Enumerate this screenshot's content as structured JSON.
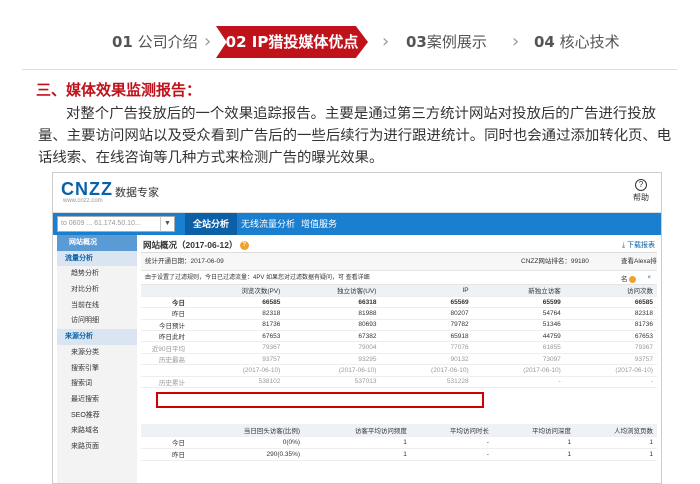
{
  "steps": [
    {
      "num": "01",
      "label": "公司介绍"
    },
    {
      "num": "02",
      "label": "IP猎投媒体优点"
    },
    {
      "num": "03",
      "label": "案例展示"
    },
    {
      "num": "04",
      "label": "核心技术"
    }
  ],
  "section_title": "三、媒体效果监测报告：",
  "paragraph": "对整个广告投放后的一个效果追踪报告。主要是通过第三方统计网站对投放后的广告进行投放量、主要访问网站以及受众看到广告后的一些后续行为进行跟进统计。同时也会通过添加转化页、电话线索、在线咨询等几种方式来检测广告的曝光效果。",
  "screenshot": {
    "logo": "CNZZ",
    "logo_sub": "www.cnzz.com",
    "brand": "数据专家",
    "help": "帮助",
    "site_select": "to 0609 ... 61.174.50.10...",
    "tabs": [
      "全站分析",
      "无线流量分析",
      "增值服务"
    ],
    "sidebar": [
      {
        "label": "网站概况",
        "type": "head"
      },
      {
        "label": "流量分析",
        "type": "group"
      },
      {
        "label": "趋势分析",
        "type": "item"
      },
      {
        "label": "对比分析",
        "type": "item"
      },
      {
        "label": "当前在线",
        "type": "item"
      },
      {
        "label": "访问明细",
        "type": "item"
      },
      {
        "label": "来源分析",
        "type": "group"
      },
      {
        "label": "来源分类",
        "type": "item"
      },
      {
        "label": "搜索引擎",
        "type": "item"
      },
      {
        "label": "搜索词",
        "type": "item"
      },
      {
        "label": "最近搜索",
        "type": "item"
      },
      {
        "label": "SEO推荐",
        "type": "item"
      },
      {
        "label": "来路域名",
        "type": "item"
      },
      {
        "label": "来路页面",
        "type": "item"
      }
    ],
    "content_title": "网站概况（2017-06-12）",
    "download": "下载报表",
    "info_start": "统计开通日期：2017-06-09",
    "info_rank": "CNZZ网站排名：99180",
    "info_alexa": "查看Alexa排名",
    "notice_text": "由于设置了过滤规则，今日已过滤流量：4PV  如果您对过滤数据有疑问，可 查看详细",
    "notice_close": "×",
    "table_headers": [
      "",
      "浏览次数(PV)",
      "独立访客(UV)",
      "IP",
      "新独立访客",
      "访问次数"
    ],
    "table_rows": [
      {
        "label": "今日",
        "values": [
          "66585",
          "66318",
          "65569",
          "65599",
          "66585"
        ],
        "style": "bold"
      },
      {
        "label": "昨日",
        "values": [
          "82318",
          "81988",
          "80207",
          "54764",
          "82318"
        ],
        "style": ""
      },
      {
        "label": "今日预计",
        "values": [
          "81736",
          "80693",
          "79782",
          "51346",
          "81736"
        ],
        "style": ""
      },
      {
        "label": "昨日此时",
        "values": [
          "67653",
          "67382",
          "65918",
          "44759",
          "67653"
        ],
        "style": ""
      },
      {
        "label": "近90日平均",
        "values": [
          "79367",
          "79004",
          "77076",
          "61855",
          "79367"
        ],
        "style": "gray"
      },
      {
        "label": "历史最高",
        "values": [
          "93757",
          "93295",
          "90132",
          "73097",
          "93757"
        ],
        "style": "gray"
      },
      {
        "label": "",
        "values": [
          "(2017-06-10)",
          "(2017-06-10)",
          "(2017-06-10)",
          "(2017-06-10)",
          "(2017-06-10)"
        ],
        "style": "gray"
      },
      {
        "label": "历史累计",
        "values": [
          "538102",
          "537013",
          "531228",
          "-",
          "-"
        ],
        "style": "gray"
      }
    ],
    "sub_headers": [
      "",
      "当日回头访客(比例)",
      "访客平均访问频度",
      "平均访问时长",
      "平均访问深度",
      "人均浏览页数"
    ],
    "sub_rows": [
      {
        "label": "今日",
        "values": [
          "0(0%)",
          "1",
          "-",
          "1",
          "1"
        ]
      },
      {
        "label": "昨日",
        "values": [
          "290(0.35%)",
          "1",
          "-",
          "1",
          "1"
        ]
      }
    ]
  }
}
